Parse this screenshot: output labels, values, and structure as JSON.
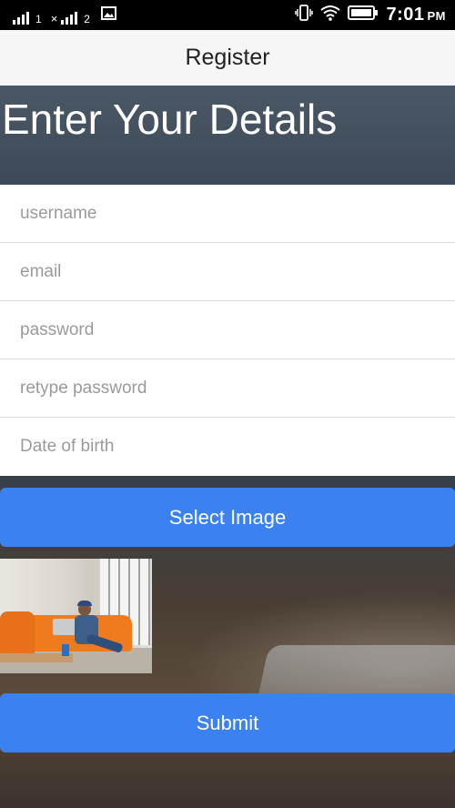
{
  "status_bar": {
    "sim1_label": "1",
    "sim2_label": "2",
    "time": "7:01",
    "ampm": "PM"
  },
  "app_bar": {
    "title": "Register"
  },
  "header": {
    "title": "Enter Your Details"
  },
  "form": {
    "fields": [
      {
        "placeholder": "username",
        "value": ""
      },
      {
        "placeholder": "email",
        "value": ""
      },
      {
        "placeholder": "password",
        "value": ""
      },
      {
        "placeholder": "retype password",
        "value": ""
      },
      {
        "placeholder": "Date of birth",
        "value": ""
      }
    ],
    "select_image_label": "Select Image",
    "submit_label": "Submit"
  },
  "colors": {
    "button": "#3b82f0",
    "status_bar": "#000000",
    "app_bar": "#f6f6f6"
  },
  "icons": [
    "signal-icon",
    "no-signal-icon",
    "gallery-icon",
    "vibrate-icon",
    "wifi-icon",
    "battery-icon"
  ]
}
